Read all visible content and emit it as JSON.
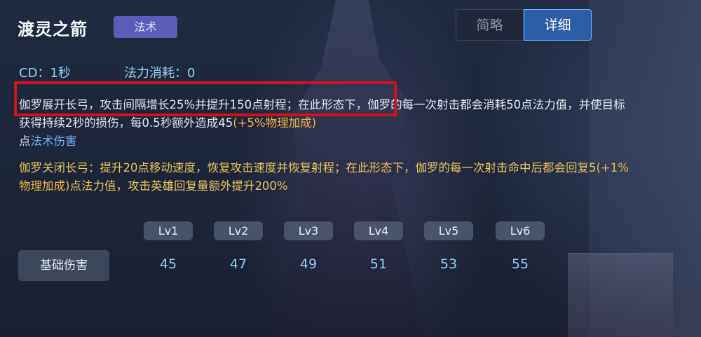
{
  "skill": {
    "name": "渡灵之箭",
    "type_tag": "法术"
  },
  "tabs": [
    {
      "label": "简略",
      "active": false
    },
    {
      "label": "详细",
      "active": true
    }
  ],
  "stats": {
    "cd": "CD：1秒",
    "mana_cost": "法力消耗：0"
  },
  "description": {
    "p1_highlighted": "伽罗展开长弓，攻击间隔增长25%并提升150点射程；",
    "p1_rest": "在此形态下，伽罗的每一次射击都会消耗50点法力值，并使目标获得持续2秒的损伤，每0.5秒额外造成45",
    "p1_ratio": "(+5%物理加成)",
    "p1_prefix": "点",
    "p1_damage_type": "法术伤害",
    "p2_text": "伽罗关闭长弓：提升20点移动速度，恢复攻击速度并恢复射程；在此形态下，伽罗的每一次射击命中后都会回复5",
    "p2_ratio": "(+1%物理加成)",
    "p2_rest": "点法力值，攻击英雄回复量额外提升200%"
  },
  "level_table": {
    "levels": [
      "Lv1",
      "Lv2",
      "Lv3",
      "Lv4",
      "Lv5",
      "Lv6"
    ],
    "row_label": "基础伤害",
    "values": [
      "45",
      "47",
      "49",
      "51",
      "53",
      "55"
    ]
  },
  "colors": {
    "accent_red_box": "#d1121d",
    "tag_purple": "#5b5db8",
    "stat_blue": "#8fd0f5",
    "ratio_orange": "#f0b63f",
    "magic_blue": "#6fb0ff"
  }
}
